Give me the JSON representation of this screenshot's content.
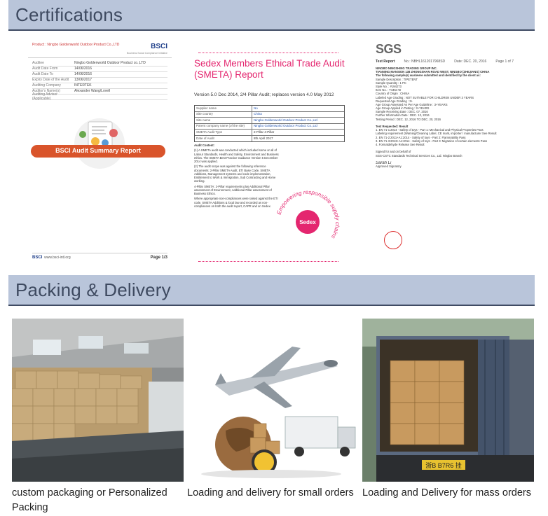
{
  "sections": {
    "certifications_title": "Certifications",
    "packing_title": "Packing & Delivery"
  },
  "bsci": {
    "product_label": "Product :",
    "company": "Ningbo Goldenworld Outdoor Product Co.,LTD",
    "logo": "BSCI",
    "logo_sub": "Business Social Compliance Initiative",
    "rows": [
      {
        "k": "Auditee",
        "v": "Ningbo Goldenworld Outdoor Product co.,LTD"
      },
      {
        "k": "Audit Date From",
        "v": "14/06/2016"
      },
      {
        "k": "Audit Date To",
        "v": "14/06/2016"
      },
      {
        "k": "Expiry Date of the Audit",
        "v": "13/06/2017"
      },
      {
        "k": "Auditing Company",
        "v": "INTERTEK"
      },
      {
        "k": "Auditor's Name(s)",
        "v": "Alexander Wang/Lovell"
      },
      {
        "k": "Auditing Advisor (Applicable)",
        "v": ""
      }
    ],
    "banner": "BSCI Audit Summary Report",
    "footer_logo": "BSCI",
    "footer_site": "www.bsci-intl.org",
    "page": "Page 1/3"
  },
  "smeta": {
    "title": "Sedex Members Ethical Trade Audit (SMETA) Report",
    "version": "Version 5.0 Dec 2014, 2/4 Pillar Audit; replaces version 4.0 May 2012",
    "rows": [
      {
        "k": "Supplier name",
        "v": "No"
      },
      {
        "k": "Site country",
        "v": "China"
      },
      {
        "k": "Site name",
        "v": "Ningbo Goldenworld Outdoor Product Co.,Ltd"
      },
      {
        "k": "Parent company name (of the site)",
        "v": "Ningbo Goldenworld Outdoor Product Co.,Ltd"
      },
      {
        "k": "SMETA Audit Type",
        "v": "2-Pillar        4-Pillar"
      },
      {
        "k": "Date of Audit",
        "v": "8th April 2017"
      }
    ],
    "body": [
      "Audit Content:",
      "(1) A SMETA audit was conducted which included some or all of Labour Standards, Health and Safety, Environment and Business ethics. The SMETA Best Practice Guidance Version 5 December 2014 was applied.",
      "(2) The audit scope was against the following reference documents: 2-Pillar SMETA Audit, ETI Base Code, SMETA Additions, Management systems and code implementation, Entitlement to Work & Immigration, Sub Contracting and Home working.",
      "4-Pillar SMETA: 2-Pillar requirements plus Additional Pillar assessment of Environment, Additional Pillar assessment of Business Ethics.",
      "Where appropriate non-compliances were raised against the ETI code, SMETA Additions & local law and recorded as non-compliances on both the audit report, CAPR and on Sedex."
    ],
    "badge": "Sedex",
    "ring_text": "Empowering responsible supply chains"
  },
  "sgs": {
    "logo": "SGS",
    "report_title": "Test Report",
    "report_no": "No.: NBHL1612017968SD",
    "date": "Date: DEC. 20, 2016",
    "page": "Page 1 of 7",
    "lines": [
      "NINGBO NINGSHING TRADING GROUP INC.",
      "TIANNING MANSION 138 ZHONGSHAN ROAD WEST, NINGBO (ZHEJIANG) CHINA",
      "The following sample(s) was/were submitted and identified by the client as:",
      "Sample Description       :  TIPETENT",
      "Sample Quantity          :  1 PC",
      "Style No.                :  #194273",
      "Item No.                 :  T4454 W",
      "Country of Origin        :  CHINA",
      "Labeled Age Grading      :  NOT SUITABLE FOR CHILDREN UNDER 3 YEARS",
      "Requested Age Grading    :  3+",
      "Age Group Assessed As Per Age Guideline : 3+YEARS",
      "Age Group Applied in Testing :  3+YEARS",
      "Sample Receiving Date    :  DEC. 07, 2016",
      "Further Information Date :  DEC. 12, 2016",
      "Testing Period           :  DEC. 12, 2016 TO DEC. 20, 2016",
      "",
      "Test Requested:                                     Result",
      "1. EN 71-1:2014 - Safety of toys - Part 1: Mechanical and Physical Properties   Pass",
      "   Labeling requirement (Warning/Cleaning Label, CE mark, importer / manufacturer  See Result",
      "2. EN 71-2:2011+A1:2014 - Safety of toys - Part 2: Flammability       Pass",
      "3. EN 71-3:2013+A1:2014 - Safety of toys - Part 3: Migration of certain elements  Pass",
      "4. Formaldehyde Release                                 See Result",
      "",
      "Signed for and on behalf of",
      "SGS-CSTC Standards Technical Services Co., Ltd. Ningbo Branch",
      "",
      "Sarah Li",
      "Approved Signatory"
    ]
  },
  "packing": {
    "captions": [
      "custom packaging or Personalized Packing",
      "Loading and delivery for small orders",
      "Loading and Delivery for mass orders"
    ],
    "truck_plate": "浙B B7R6 挂"
  }
}
